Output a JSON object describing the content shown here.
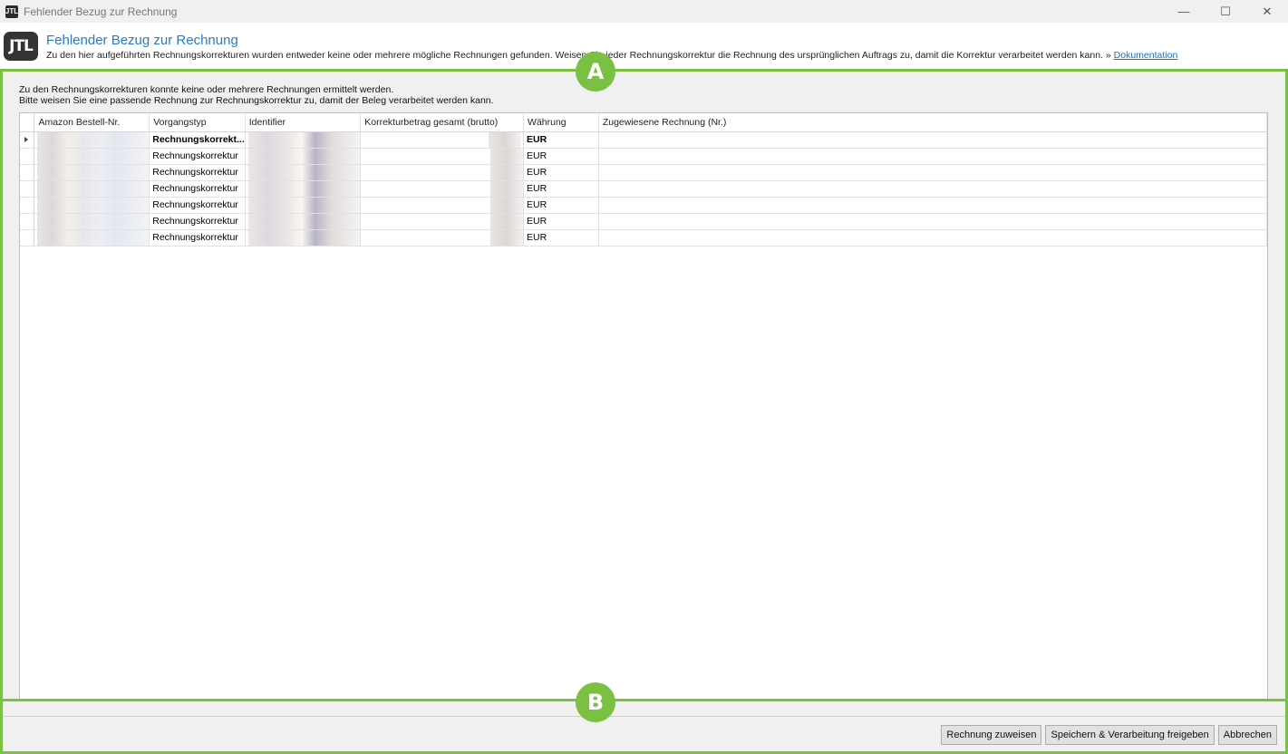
{
  "window": {
    "title": "Fehlender Bezug zur Rechnung",
    "minimize_icon": "minimize-icon",
    "maximize_icon": "maximize-icon",
    "close_icon": "close-icon"
  },
  "header": {
    "logo_text": "JTL",
    "title": "Fehlender Bezug zur Rechnung",
    "description": "Zu den hier aufgeführten Rechnungskorrekturen wurden entweder keine oder mehrere mögliche Rechnungen gefunden. Weisen Sie jeder Rechnungskorrektur die Rechnung des ursprünglichen Auftrags zu, damit die Korrektur verarbeitet werden kann. »",
    "doc_link": "Dokumentation"
  },
  "info": {
    "line1": "Zu den Rechnungskorrekturen konnte keine oder mehrere Rechnungen ermittelt werden.",
    "line2": "Bitte weisen Sie eine passende Rechnung zur Rechnungskorrektur zu, damit der Beleg verarbeitet werden kann."
  },
  "grid": {
    "columns": [
      "Amazon Bestell-Nr.",
      "Vorgangstyp",
      "Identifier",
      "Korrekturbetrag gesamt (brutto)",
      "Währung",
      "Zugewiesene Rechnung (Nr.)"
    ],
    "rows": [
      {
        "type": "Rechnungskorrekt...",
        "currency": "EUR"
      },
      {
        "type": "Rechnungskorrektur",
        "currency": "EUR"
      },
      {
        "type": "Rechnungskorrektur",
        "currency": "EUR"
      },
      {
        "type": "Rechnungskorrektur",
        "currency": "EUR"
      },
      {
        "type": "Rechnungskorrektur",
        "currency": "EUR"
      },
      {
        "type": "Rechnungskorrektur",
        "currency": "EUR"
      },
      {
        "type": "Rechnungskorrektur",
        "currency": "EUR"
      }
    ]
  },
  "markers": {
    "a": "A",
    "b": "B"
  },
  "footer": {
    "assign_button": "Rechnung zuweisen",
    "save_button": "Speichern & Verarbeitung freigeben",
    "cancel_button": "Abbrechen"
  },
  "colors": {
    "accent_green": "#7ac143",
    "link_blue": "#1f6fbf",
    "title_blue": "#2b7bbf"
  }
}
